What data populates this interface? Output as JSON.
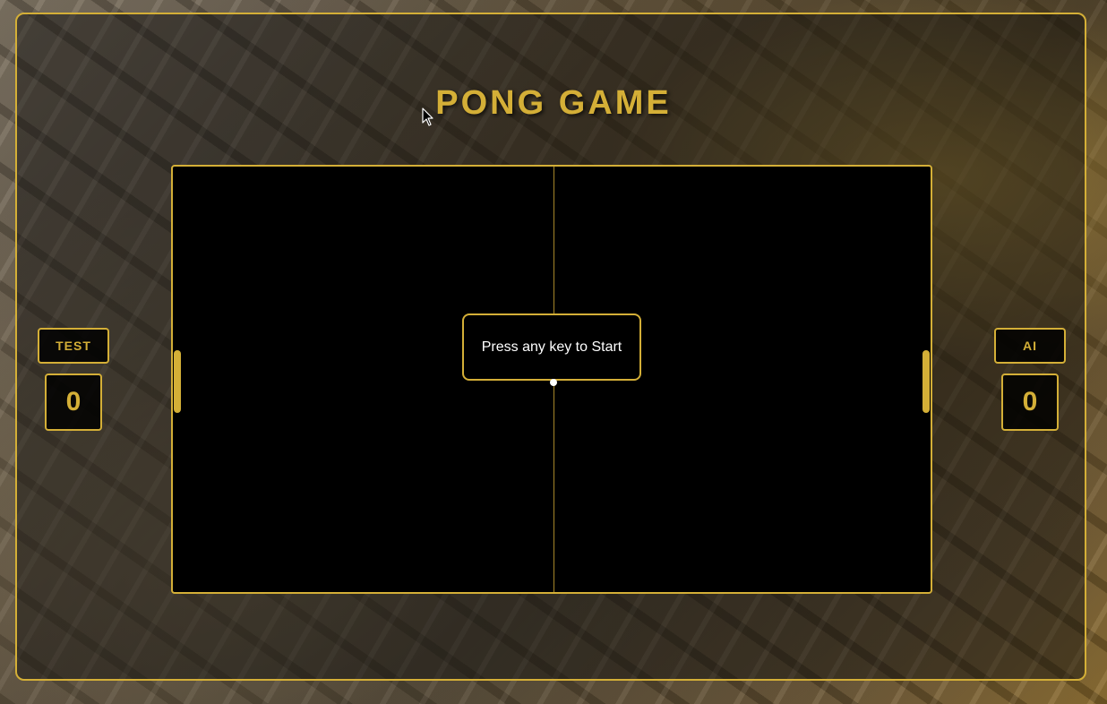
{
  "title": "PONG GAME",
  "players": {
    "left": {
      "name": "TEST",
      "score": "0"
    },
    "right": {
      "name": "AI",
      "score": "0"
    }
  },
  "overlay": {
    "message": "Press any key to Start"
  },
  "colors": {
    "accent": "#d4af37",
    "field": "#000000",
    "ball": "#ffffff"
  },
  "icons": {
    "cursor": "mouse-pointer-icon"
  }
}
